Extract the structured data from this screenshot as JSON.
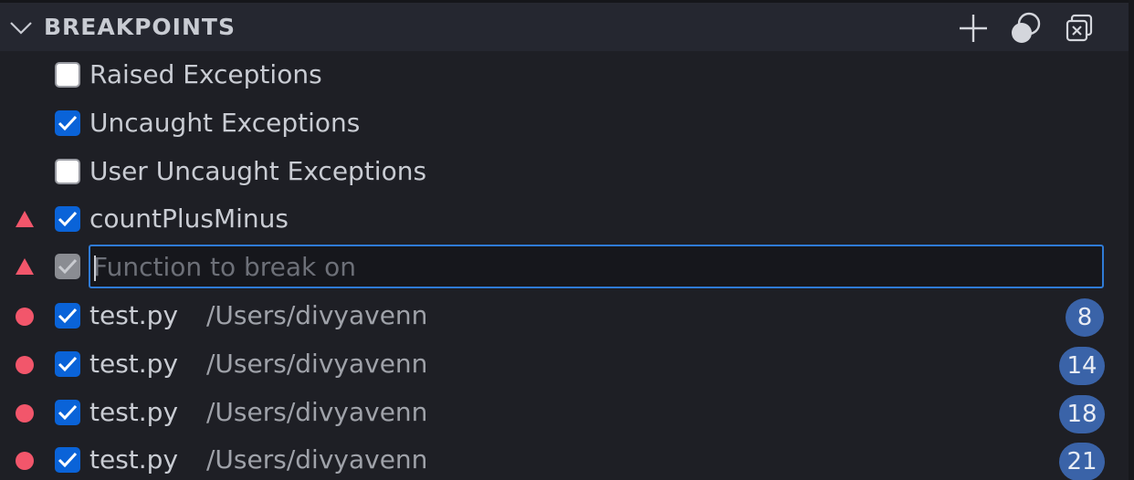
{
  "header": {
    "title": "BREAKPOINTS",
    "actions": {
      "add_icon": "plus-icon",
      "toggle_icon": "toggle-activate-breakpoints-icon",
      "remove_all_icon": "remove-all-breakpoints-icon"
    }
  },
  "exceptions": [
    {
      "label": "Raised Exceptions",
      "checked": false
    },
    {
      "label": "Uncaught Exceptions",
      "checked": true
    },
    {
      "label": "User Uncaught Exceptions",
      "checked": false
    }
  ],
  "function_breakpoints": [
    {
      "label": "countPlusMinus",
      "checked": true,
      "marker_icon": "function-breakpoint-triangle-icon"
    }
  ],
  "new_function_input": {
    "placeholder": "Function to break on",
    "value": "",
    "checked": true,
    "marker_icon": "function-breakpoint-triangle-icon"
  },
  "source_breakpoints": [
    {
      "file": "test.py",
      "path": "/Users/divyavenn",
      "line": "8",
      "checked": true
    },
    {
      "file": "test.py",
      "path": "/Users/divyavenn",
      "line": "14",
      "checked": true
    },
    {
      "file": "test.py",
      "path": "/Users/divyavenn",
      "line": "18",
      "checked": true
    },
    {
      "file": "test.py",
      "path": "/Users/divyavenn",
      "line": "21",
      "checked": true
    }
  ],
  "colors": {
    "background": "#1e1f25",
    "header_background": "#252730",
    "checkbox_checked": "#0a63d8",
    "breakpoint_marker": "#f2566b",
    "badge": "#3a63a8",
    "input_focus_border": "#2f7bd6"
  }
}
